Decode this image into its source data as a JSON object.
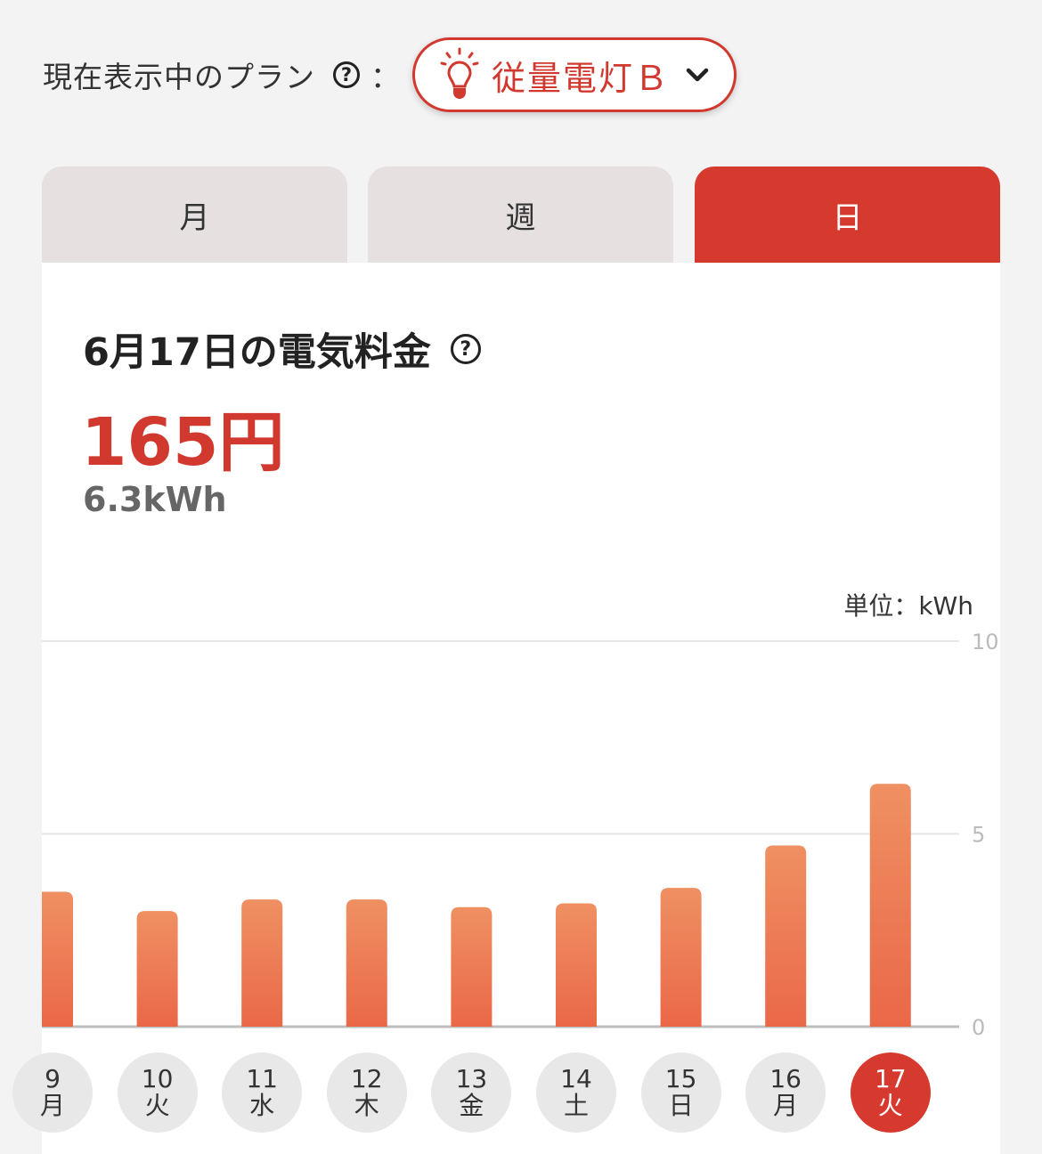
{
  "plan": {
    "label": "現在表示中のプラン",
    "help": "?",
    "colon": "：",
    "selected": "従量電灯Ｂ",
    "accent": "#d1392f"
  },
  "tabs": [
    {
      "label": "月",
      "active": false
    },
    {
      "label": "週",
      "active": false
    },
    {
      "label": "日",
      "active": true
    }
  ],
  "summary": {
    "title": "6月17日の電気料金",
    "help": "?",
    "price": "165円",
    "usage": "6.3kWh"
  },
  "chart_data": {
    "type": "bar",
    "unit_label": "単位：kWh",
    "categories": [
      "9",
      "10",
      "11",
      "12",
      "13",
      "14",
      "15",
      "16",
      "17"
    ],
    "weekdays": [
      "月",
      "火",
      "水",
      "木",
      "金",
      "土",
      "日",
      "月",
      "火"
    ],
    "values": [
      3.5,
      3.0,
      3.3,
      3.3,
      3.1,
      3.2,
      3.6,
      4.7,
      6.3
    ],
    "yticks": [
      "10",
      "5",
      "0"
    ],
    "ylim": [
      0,
      10
    ],
    "selected_index": 8,
    "bar_color_top": "#ef9062",
    "bar_color_bottom": "#ea6848",
    "grid": true
  }
}
